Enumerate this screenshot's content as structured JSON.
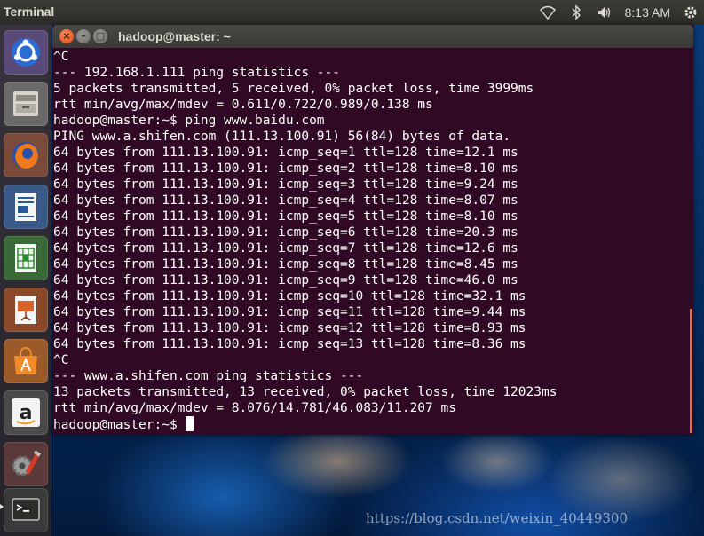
{
  "top_panel": {
    "app_name": "Terminal",
    "clock": "8:13 AM",
    "indicators": [
      "wifi-icon",
      "bluetooth-icon",
      "volume-icon",
      "settings-gear-icon"
    ]
  },
  "launcher": {
    "items": [
      {
        "name": "ubuntu-dash-icon"
      },
      {
        "name": "files-icon"
      },
      {
        "name": "firefox-icon"
      },
      {
        "name": "libreoffice-writer-icon"
      },
      {
        "name": "libreoffice-calc-icon"
      },
      {
        "name": "libreoffice-impress-icon"
      },
      {
        "name": "software-center-icon"
      },
      {
        "name": "amazon-icon"
      },
      {
        "name": "system-settings-icon"
      },
      {
        "name": "terminal-icon"
      }
    ]
  },
  "window": {
    "title": "hadoop@master: ~",
    "close_glyph": "×",
    "minimize_glyph": "–",
    "maximize_glyph": "□"
  },
  "terminal": {
    "lines": [
      "^C",
      "--- 192.168.1.111 ping statistics ---",
      "5 packets transmitted, 5 received, 0% packet loss, time 3999ms",
      "rtt min/avg/max/mdev = 0.611/0.722/0.989/0.138 ms",
      "hadoop@master:~$ ping www.baidu.com",
      "PING www.a.shifen.com (111.13.100.91) 56(84) bytes of data.",
      "64 bytes from 111.13.100.91: icmp_seq=1 ttl=128 time=12.1 ms",
      "64 bytes from 111.13.100.91: icmp_seq=2 ttl=128 time=8.10 ms",
      "64 bytes from 111.13.100.91: icmp_seq=3 ttl=128 time=9.24 ms",
      "64 bytes from 111.13.100.91: icmp_seq=4 ttl=128 time=8.07 ms",
      "64 bytes from 111.13.100.91: icmp_seq=5 ttl=128 time=8.10 ms",
      "64 bytes from 111.13.100.91: icmp_seq=6 ttl=128 time=20.3 ms",
      "64 bytes from 111.13.100.91: icmp_seq=7 ttl=128 time=12.6 ms",
      "64 bytes from 111.13.100.91: icmp_seq=8 ttl=128 time=8.45 ms",
      "64 bytes from 111.13.100.91: icmp_seq=9 ttl=128 time=46.0 ms",
      "64 bytes from 111.13.100.91: icmp_seq=10 ttl=128 time=32.1 ms",
      "64 bytes from 111.13.100.91: icmp_seq=11 ttl=128 time=9.44 ms",
      "64 bytes from 111.13.100.91: icmp_seq=12 ttl=128 time=8.93 ms",
      "64 bytes from 111.13.100.91: icmp_seq=13 ttl=128 time=8.36 ms",
      "^C",
      "--- www.a.shifen.com ping statistics ---",
      "13 packets transmitted, 13 received, 0% packet loss, time 12023ms",
      "rtt min/avg/max/mdev = 8.076/14.781/46.083/11.207 ms"
    ],
    "prompt": "hadoop@master:~$ "
  },
  "watermark": "https://blog.csdn.net/weixin_40449300",
  "colors": {
    "terminal_bg": "#300a24",
    "terminal_fg": "#ffffff",
    "accent_orange": "#e8723a",
    "panel_bg": "#3c3b37"
  }
}
